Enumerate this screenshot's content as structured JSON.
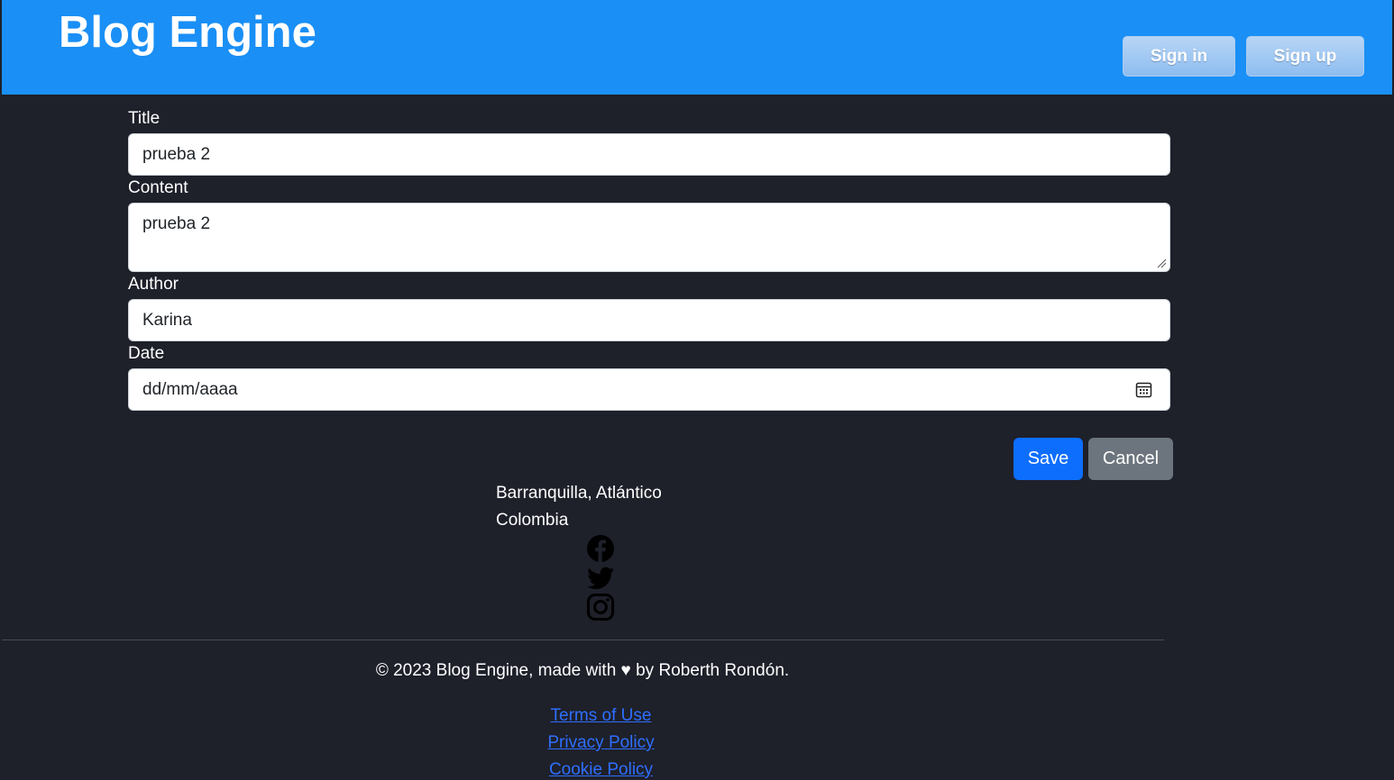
{
  "header": {
    "brand": "Blog Engine",
    "sign_in": "Sign in",
    "sign_up": "Sign up"
  },
  "form": {
    "title_label": "Title",
    "title_value": "prueba 2",
    "content_label": "Content",
    "content_value": "prueba 2",
    "author_label": "Author",
    "author_value": "Karina",
    "date_label": "Date",
    "date_placeholder": "dd/mm/aaaa",
    "save_label": "Save",
    "cancel_label": "Cancel"
  },
  "footer": {
    "address_line1": "Barranquilla, Atlántico",
    "address_line2": "Colombia",
    "social_icons": [
      "facebook-icon",
      "twitter-icon",
      "instagram-icon"
    ],
    "copyright": "© 2023 Blog Engine, made with ♥ by Roberth Rondón.",
    "links": [
      "Terms of Use",
      "Privacy Policy",
      "Cookie Policy"
    ]
  },
  "colors": {
    "header_bg": "#1a8ff5",
    "page_bg": "#1e202a",
    "primary": "#0d6efd",
    "secondary": "#6c757d",
    "link": "#2e6fff"
  }
}
